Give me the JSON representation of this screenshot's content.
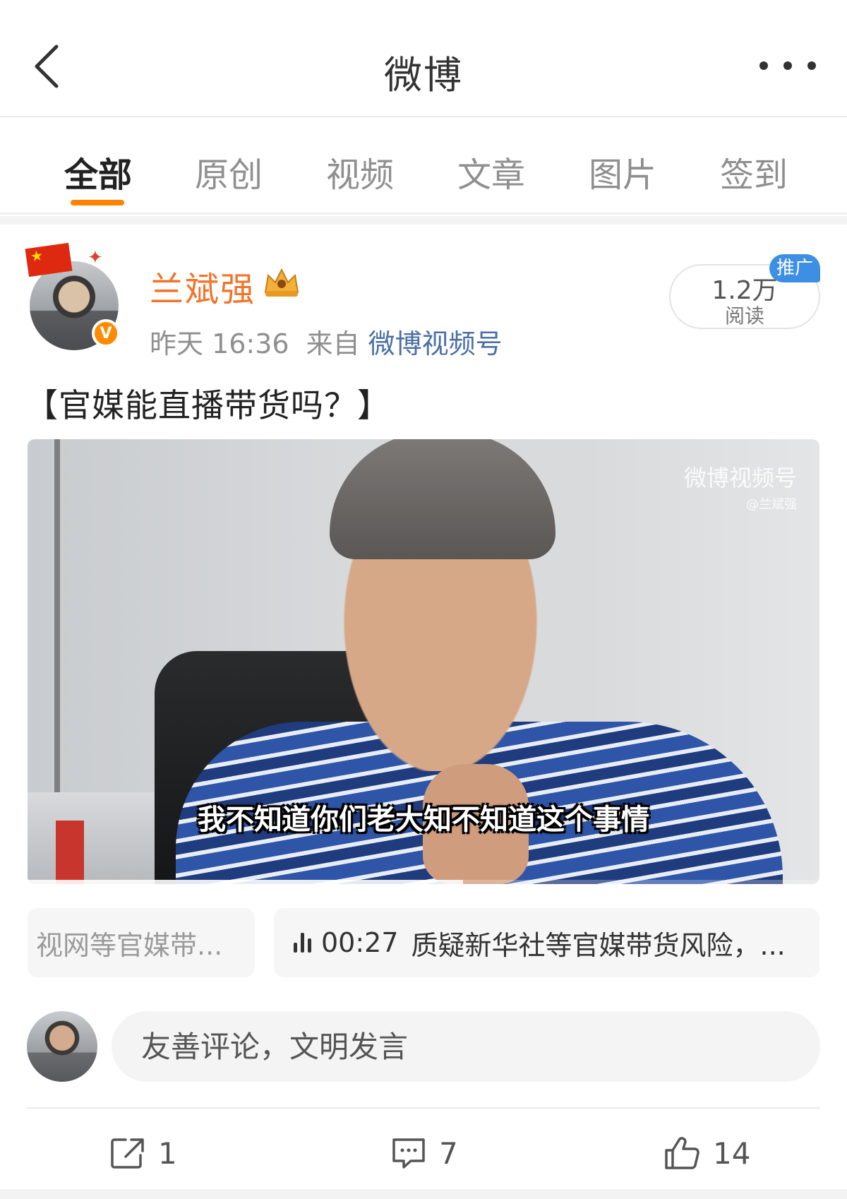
{
  "header": {
    "title": "微博"
  },
  "tabs": [
    {
      "label": "全部",
      "active": true
    },
    {
      "label": "原创",
      "active": false
    },
    {
      "label": "视频",
      "active": false
    },
    {
      "label": "文章",
      "active": false
    },
    {
      "label": "图片",
      "active": false
    },
    {
      "label": "签到",
      "active": false
    }
  ],
  "post": {
    "author": "兰斌强",
    "time": "昨天 16:36",
    "from_label": "来自",
    "source": "微博视频号",
    "read_count": "1.2万",
    "read_label": "阅读",
    "promo_badge": "推广",
    "text": "【官媒能直播带货吗？】",
    "video": {
      "watermark": "微博视频号",
      "watermark_user": "@兰斌强",
      "subtitle": "我不知道你们老大知不知道这个事情",
      "progress": 0.55
    },
    "chapters": [
      {
        "text": "视网等官媒带..."
      },
      {
        "time": "00:27",
        "text": "质疑新华社等官媒带货风险，..."
      }
    ]
  },
  "comment_box": {
    "placeholder": "友善评论，文明发言"
  },
  "actions": {
    "share_count": "1",
    "comment_count": "7",
    "like_count": "14"
  },
  "colors": {
    "accent": "#ff8200",
    "username": "#f2742b",
    "source_link": "#4a6fa5",
    "promo": "#3d8fe6"
  },
  "icons": [
    "back-arrow-icon",
    "more-icon",
    "verified-icon",
    "crown-icon",
    "audio-bars-icon",
    "share-icon",
    "comment-icon",
    "like-icon"
  ]
}
